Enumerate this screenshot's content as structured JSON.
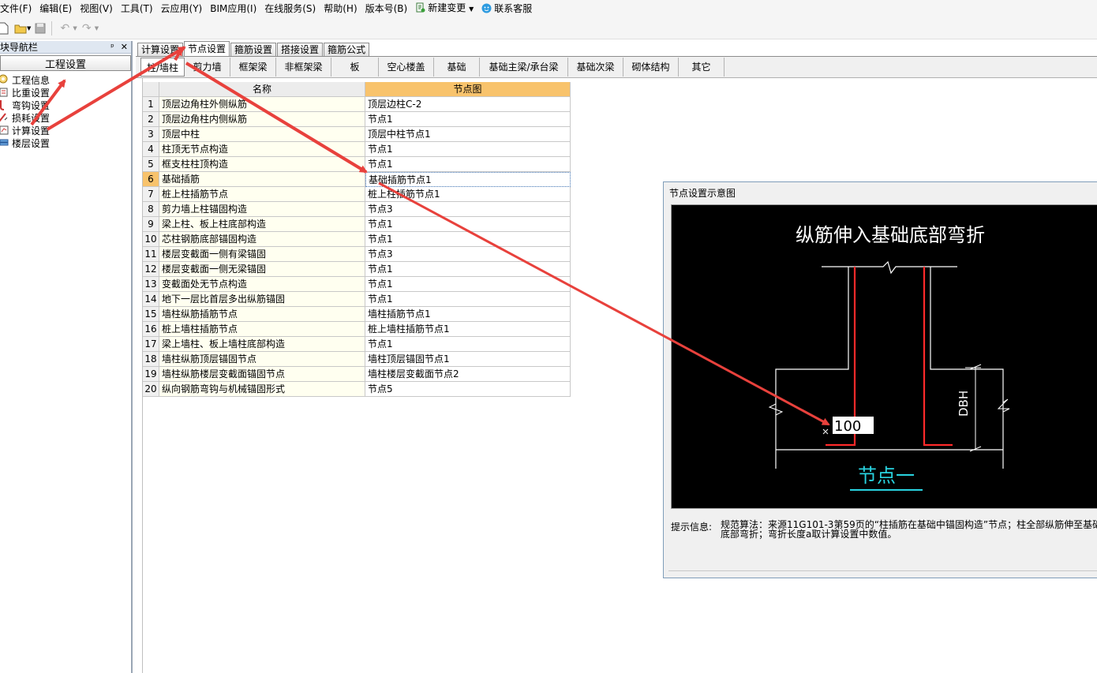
{
  "menu": [
    "文件(F)",
    "编辑(E)",
    "视图(V)",
    "工具(T)",
    "云应用(Y)",
    "BIM应用(I)",
    "在线服务(S)",
    "帮助(H)",
    "版本号(B)",
    "新建变更",
    "联系客服"
  ],
  "nav": {
    "title": "模块导航栏",
    "pin": "ᵖ",
    "close": "✕",
    "section": "工程设置",
    "items": [
      "工程信息",
      "比重设置",
      "弯钩设置",
      "损耗设置",
      "计算设置",
      "楼层设置"
    ]
  },
  "tabs": [
    "计算设置",
    "节点设置",
    "箍筋设置",
    "搭接设置",
    "箍筋公式"
  ],
  "subtabs": [
    "柱/墙柱",
    "剪力墙",
    "框架梁",
    "非框架梁",
    "板",
    "空心楼盖",
    "基础",
    "基础主梁/承台梁",
    "基础次梁",
    "砌体结构",
    "其它"
  ],
  "table": {
    "headers": [
      "名称",
      "节点图"
    ],
    "rows": [
      {
        "n": "1",
        "name": "顶层边角柱外侧纵筋",
        "node": "顶层边柱C-2"
      },
      {
        "n": "2",
        "name": "顶层边角柱内侧纵筋",
        "node": "节点1"
      },
      {
        "n": "3",
        "name": "顶层中柱",
        "node": "顶层中柱节点1"
      },
      {
        "n": "4",
        "name": "柱顶无节点构造",
        "node": "节点1"
      },
      {
        "n": "5",
        "name": "框支柱柱顶构造",
        "node": "节点1"
      },
      {
        "n": "6",
        "name": "基础插筋",
        "node": "基础插筋节点1"
      },
      {
        "n": "7",
        "name": "桩上柱插筋节点",
        "node": "桩上柱插筋节点1"
      },
      {
        "n": "8",
        "name": "剪力墙上柱锚固构造",
        "node": "节点3"
      },
      {
        "n": "9",
        "name": "梁上柱、板上柱底部构造",
        "node": "节点1"
      },
      {
        "n": "10",
        "name": "芯柱钢筋底部锚固构造",
        "node": "节点1"
      },
      {
        "n": "11",
        "name": "楼层变截面一侧有梁锚固",
        "node": "节点3"
      },
      {
        "n": "12",
        "name": "楼层变截面一侧无梁锚固",
        "node": "节点1"
      },
      {
        "n": "13",
        "name": "变截面处无节点构造",
        "node": "节点1"
      },
      {
        "n": "14",
        "name": "地下一层比首层多出纵筋锚固",
        "node": "节点1"
      },
      {
        "n": "15",
        "name": "墙柱纵筋插筋节点",
        "node": "墙柱插筋节点1"
      },
      {
        "n": "16",
        "name": "桩上墙柱插筋节点",
        "node": "桩上墙柱插筋节点1"
      },
      {
        "n": "17",
        "name": "梁上墙柱、板上墙柱底部构造",
        "node": "节点1"
      },
      {
        "n": "18",
        "name": "墙柱纵筋顶层锚固节点",
        "node": "墙柱顶层锚固节点1"
      },
      {
        "n": "19",
        "name": "墙柱纵筋楼层变截面锚固节点",
        "node": "墙柱楼层变截面节点2"
      },
      {
        "n": "20",
        "name": "纵向钢筋弯钩与机械锚固形式",
        "node": "节点5"
      }
    ]
  },
  "dialog": {
    "title": "节点设置示意图",
    "diagram_title": "纵筋伸入基础底部弯折",
    "bend_value": "100",
    "dim_label": "DBH",
    "node_label": "节点一",
    "hint_label": "提示信息:",
    "hint_text": "规范算法：来源11G101-3第59页的“柱插筋在基础中锚固构造”节点；柱全部纵筋伸至基础底部弯折；弯折长度a取计算设置中数值。"
  },
  "colors": {
    "accent_orange": "#f8c36c",
    "arrow_red": "#e8413c",
    "rebar_red": "#ff2a2a",
    "node_cyan": "#29d3e0"
  }
}
